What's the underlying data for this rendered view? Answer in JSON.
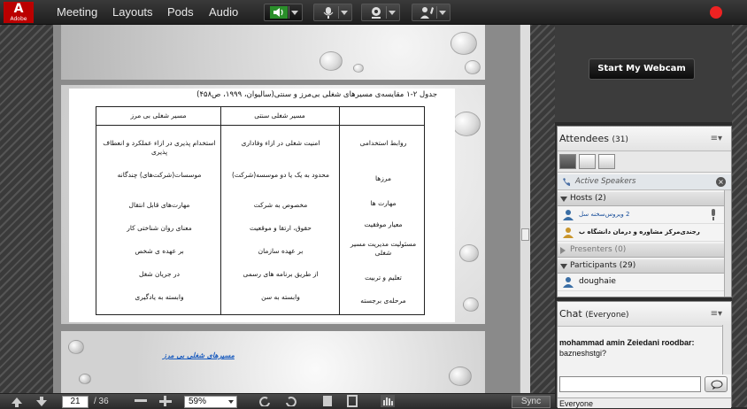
{
  "app": {
    "logo_letter": "A",
    "logo_text": "Adobe",
    "menu": [
      "Meeting",
      "Layouts",
      "Pods",
      "Audio"
    ],
    "toolbar_icons": [
      "speaker-icon",
      "microphone-icon",
      "webcam-icon",
      "raise-hand-icon"
    ],
    "accent": "#e22222"
  },
  "document": {
    "table_caption": "جدول ۲-۱ مقایسه‌ی مسیرهای شغلی بی‌مرز و سنتی(سالیوان، ۱۹۹۹، ص۴۵۸)",
    "columns": [
      "روابط استخدامی",
      "مسیر شغلی سنتی",
      "مسیر شغلی بی مرز"
    ],
    "rows": [
      [
        "روابط استخدامی",
        "امنیت شغلی در ازاء وفاداری",
        "استخدام پذیری در ازاء عملکرد و انعطاف پذیری"
      ],
      [
        "مرزها",
        "محدود به یک یا دو موسسه(شرکت)",
        "موسسات(شرکت‌های) چندگانه"
      ],
      [
        "مهارت ها",
        "مخصوص به شرکت",
        "مهارت‌های قابل انتقال"
      ],
      [
        "معیار موفقیت",
        "حقوق، ارتقا و موقعیت",
        "معنای روان شناختی کار"
      ],
      [
        "مسئولیت مدیریت مسیر شغلی",
        "بر عهده سازمان",
        "بر عهده ی شخص"
      ],
      [
        "تعلیم و تربیت",
        "از طریق برنامه های رسمی",
        "در جریان شغل"
      ],
      [
        "مرحله‌ی برجسته",
        "وابسته به سن",
        "وابسته به یادگیری"
      ]
    ],
    "next_slide_link": "مسیرهای شغلی بی مرز"
  },
  "bottom": {
    "page": "21",
    "total": "/ 36",
    "zoom": "59%",
    "sync": "Sync"
  },
  "webcam": {
    "button": "Start My Webcam"
  },
  "attendees": {
    "title": "Attendees",
    "count": "(31)",
    "active_speakers": "Active Speakers",
    "hosts_label": "Hosts (2)",
    "hosts": [
      "2 ویروس‌سخنه سل",
      "رجندی‌مرکز مشاوره و درمان دانشگاه ب"
    ],
    "presenters_label": "Presenters (0)",
    "participants_label": "Participants (29)",
    "participants": [
      "doughaie"
    ]
  },
  "chat": {
    "title": "Chat",
    "scope": "(Everyone)",
    "messages": [
      {
        "author": "mohammad amin Zeiedani roodbar:",
        "text": "bazneshstgi?"
      }
    ],
    "target": "Everyone"
  }
}
